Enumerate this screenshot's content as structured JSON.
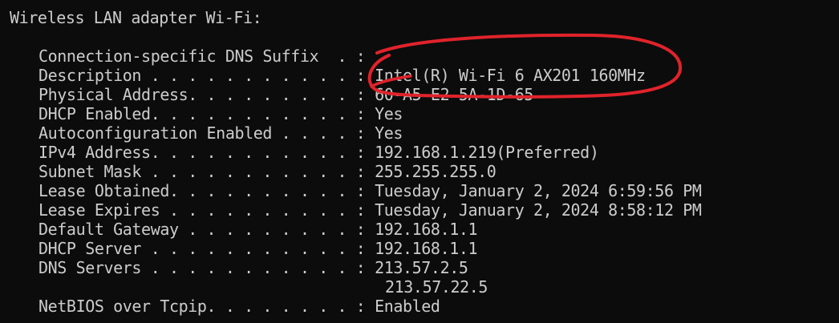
{
  "terminal": {
    "section_header": "Wireless LAN adapter Wi-Fi:",
    "entries": [
      {
        "label": "Connection-specific DNS Suffix  . :",
        "value": ""
      },
      {
        "label": "Description . . . . . . . . . . . :",
        "value": " Intel(R) Wi-Fi 6 AX201 160MHz"
      },
      {
        "label": "Physical Address. . . . . . . . . :",
        "value": " 60-A5-E2-5A-1D-65"
      },
      {
        "label": "DHCP Enabled. . . . . . . . . . . :",
        "value": " Yes"
      },
      {
        "label": "Autoconfiguration Enabled . . . . :",
        "value": " Yes"
      },
      {
        "label": "IPv4 Address. . . . . . . . . . . :",
        "value": " 192.168.1.219(Preferred)"
      },
      {
        "label": "Subnet Mask . . . . . . . . . . . :",
        "value": " 255.255.255.0"
      },
      {
        "label": "Lease Obtained. . . . . . . . . . :",
        "value": " Tuesday, January 2, 2024 6:59:56 PM"
      },
      {
        "label": "Lease Expires . . . . . . . . . . :",
        "value": " Tuesday, January 2, 2024 8:58:12 PM"
      },
      {
        "label": "Default Gateway . . . . . . . . . :",
        "value": " 192.168.1.1"
      },
      {
        "label": "DHCP Server . . . . . . . . . . . :",
        "value": " 192.168.1.1"
      },
      {
        "label": "DNS Servers . . . . . . . . . . . :",
        "value": " 213.57.2.5"
      }
    ],
    "dns_server_secondary": "213.57.22.5",
    "netbios": {
      "label": "NetBIOS over Tcpip. . . . . . . . :",
      "value": " Enabled"
    }
  },
  "colors": {
    "background": "#0c0c0c",
    "text": "#cccccc",
    "annotation": "#e0232b"
  }
}
